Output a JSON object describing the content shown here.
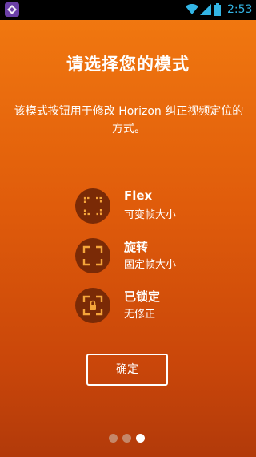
{
  "status_bar": {
    "time": "2:53",
    "icons": [
      "app-icon",
      "wifi-icon",
      "signal-icon",
      "battery-icon"
    ]
  },
  "title": "请选择您的模式",
  "description": "该模式按钮用于修改 Horizon 纠正视频定位的方式。",
  "modes": [
    {
      "icon": "flex-frame-icon",
      "title": "Flex",
      "subtitle": "可变帧大小"
    },
    {
      "icon": "rotate-frame-icon",
      "title": "旋转",
      "subtitle": "固定帧大小"
    },
    {
      "icon": "locked-frame-icon",
      "title": "已锁定",
      "subtitle": "无修正"
    }
  ],
  "confirm_label": "确定",
  "pagination": {
    "total": 3,
    "active_index": 2
  },
  "colors": {
    "background_top": "#f27a10",
    "background_bottom": "#b23a0a",
    "icon_circle": "#7a2a06",
    "icon_accent": "#f5a53a",
    "clock": "#33b5e5"
  }
}
